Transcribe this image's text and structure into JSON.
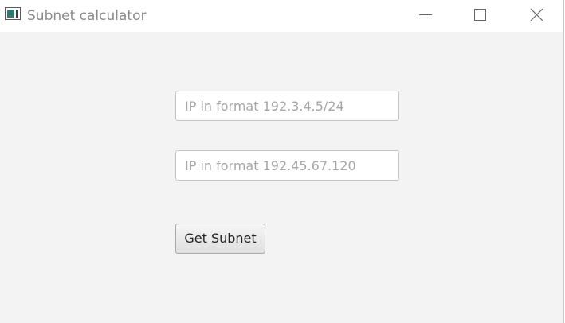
{
  "window": {
    "title": "Subnet calculator",
    "icon": "app-window-icon",
    "controls": [
      "minimize-icon",
      "maximize-icon",
      "close-icon"
    ]
  },
  "form": {
    "ip_field": {
      "value": "",
      "placeholder": "IP in format 192.3.4.5/24"
    },
    "host_field": {
      "value": "",
      "placeholder": "IP in format 192.45.67.120"
    },
    "submit_label": "Get Subnet"
  },
  "colors": {
    "titlebar": "#ffffff",
    "background": "#f3f3f3",
    "title_text": "#8b8b8b",
    "placeholder_text": "#a6a6a6",
    "icon_accent": "#2f7b74"
  }
}
